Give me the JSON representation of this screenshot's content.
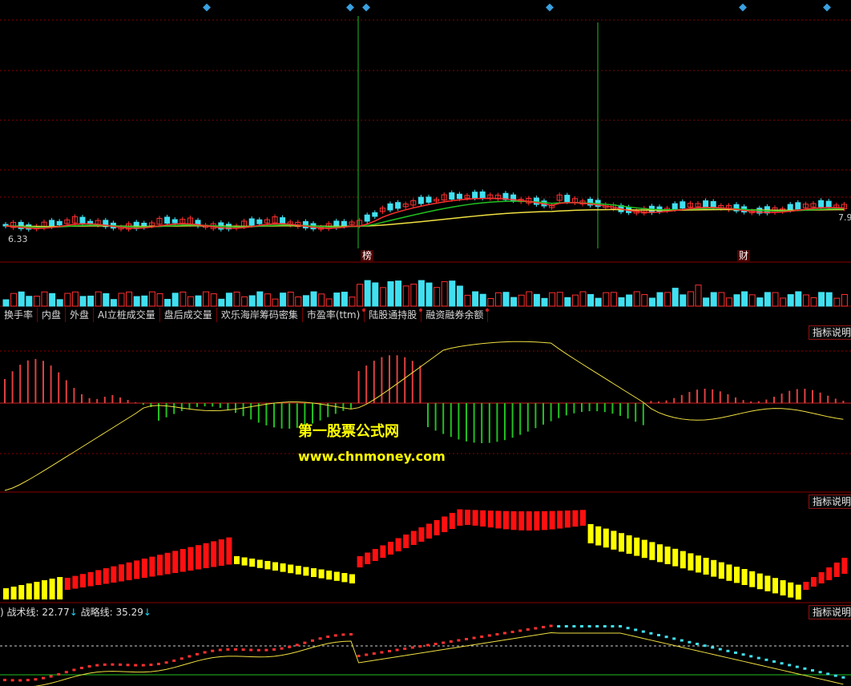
{
  "price_pane": {
    "low_label": "6.33",
    "right_label": "7.9",
    "event_badges": [
      "榜",
      "财"
    ]
  },
  "tabs": [
    {
      "label": "换手率",
      "dot": false
    },
    {
      "label": "内盘",
      "dot": false
    },
    {
      "label": "外盘",
      "dot": false
    },
    {
      "label": "AI立桩成交量",
      "dot": false
    },
    {
      "label": "盘后成交量",
      "dot": false
    },
    {
      "label": "欢乐海岸筹码密集",
      "dot": false
    },
    {
      "label": "市盈率(ttm)",
      "dot": true
    },
    {
      "label": "陆股通持股",
      "dot": true
    },
    {
      "label": "融资融券余额",
      "dot": true
    }
  ],
  "indicator_button_label": "指标说明",
  "watermark": {
    "title": "第一股票公式网",
    "url": "www.chnmoney.com"
  },
  "legend": {
    "prefix": ")",
    "tactic_label": "战术线:",
    "tactic_value": "22.77",
    "tactic_arrow": "↓",
    "strategy_label": "战略线:",
    "strategy_value": "35.29",
    "strategy_arrow": "↓"
  },
  "colors": {
    "up": "#ff3030",
    "down": "#40e0f0",
    "ma_fast": "#ff3030",
    "ma_mid": "#20c020",
    "ma_slow": "#f0e040",
    "macd_up": "#e04040",
    "macd_down": "#20c020",
    "signal_line": "#f0e040",
    "yellow_bar": "#ffff00",
    "red_bar": "#ff1010",
    "grid": "#8a0000"
  }
}
